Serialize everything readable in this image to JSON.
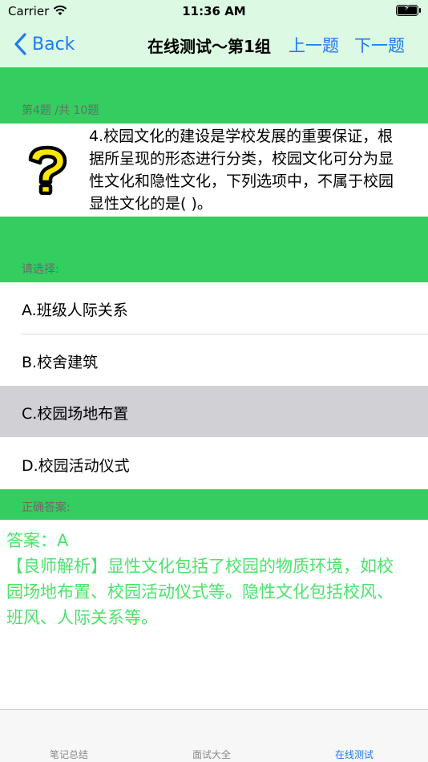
{
  "status_bar": {
    "carrier": "Carrier",
    "time": "11:36 AM"
  },
  "nav": {
    "back_label": "Back",
    "title": "在线测试～第1组",
    "prev_label": "上一题",
    "next_label": "下一题"
  },
  "question": {
    "progress_label": "第4题 /共 10题",
    "text": "4.校园文化的建设是学校发展的重要保证，根据所呈现的形态进行分类，校园文化可分为显性文化和隐性文化，下列选项中，不属于校园显性文化的是(   )。"
  },
  "options_header": "请选择:",
  "options": [
    {
      "label": "A.班级人际关系"
    },
    {
      "label": "B.校舍建筑"
    },
    {
      "label": "C.校园场地布置"
    },
    {
      "label": "D.校园活动仪式"
    }
  ],
  "selected_option": "C",
  "answer_header": "正确答案:",
  "answer": {
    "answer_line": "答案：A",
    "explanation": "【良师解析】显性文化包括了校园的物质环境，如校园场地布置、校园活动仪式等。隐性文化包括校风、班风、人际关系等。"
  },
  "tabs": [
    {
      "label": "笔记总结",
      "active": false
    },
    {
      "label": "面试大全",
      "active": false
    },
    {
      "label": "在线测试",
      "active": true
    }
  ],
  "colors": {
    "accent_green": "#34cd5f",
    "nav_bg": "#dcf9e3",
    "link_blue": "#1e7bf2",
    "answer_green": "#4be36b",
    "selected_bg": "#d0d0d5"
  },
  "icons": {
    "question_icon": "question-mark-icon",
    "wifi": "wifi-icon",
    "battery": "battery-charging-icon",
    "back": "chevron-left-icon"
  }
}
